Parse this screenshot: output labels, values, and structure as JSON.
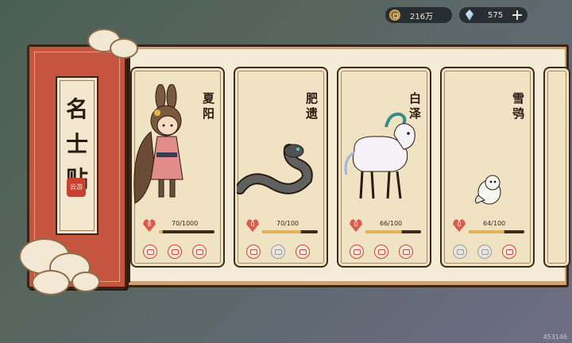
{
  "currency": {
    "coins": "216万",
    "gems": "575"
  },
  "book": {
    "title_chars": [
      "名",
      "士",
      "贴"
    ],
    "seal_text": "云游"
  },
  "cards": [
    {
      "name": "夏阳",
      "hearts": "8",
      "progress_label": "70/1000",
      "progress": 0.07,
      "actions": [
        "scroll",
        "fox",
        "house"
      ],
      "inactive": []
    },
    {
      "name": "肥遗",
      "hearts": "0",
      "progress_label": "70/100",
      "progress": 0.7,
      "actions": [
        "scroll",
        "fox",
        "house"
      ],
      "inactive": [
        1
      ]
    },
    {
      "name": "白泽",
      "hearts": "0",
      "progress_label": "66/100",
      "progress": 0.66,
      "actions": [
        "scroll",
        "fox",
        "house"
      ],
      "inactive": []
    },
    {
      "name": "雪鸮",
      "hearts": "0",
      "progress_label": "64/100",
      "progress": 0.64,
      "actions": [
        "scroll",
        "fox",
        "house"
      ],
      "inactive": [
        0,
        1
      ]
    }
  ],
  "watermark": "453146",
  "colors": {
    "cover": "#c5553f",
    "heart": "#dc5a4a",
    "bar_fill": "#e1b45a",
    "action_active": "#c74a35"
  }
}
